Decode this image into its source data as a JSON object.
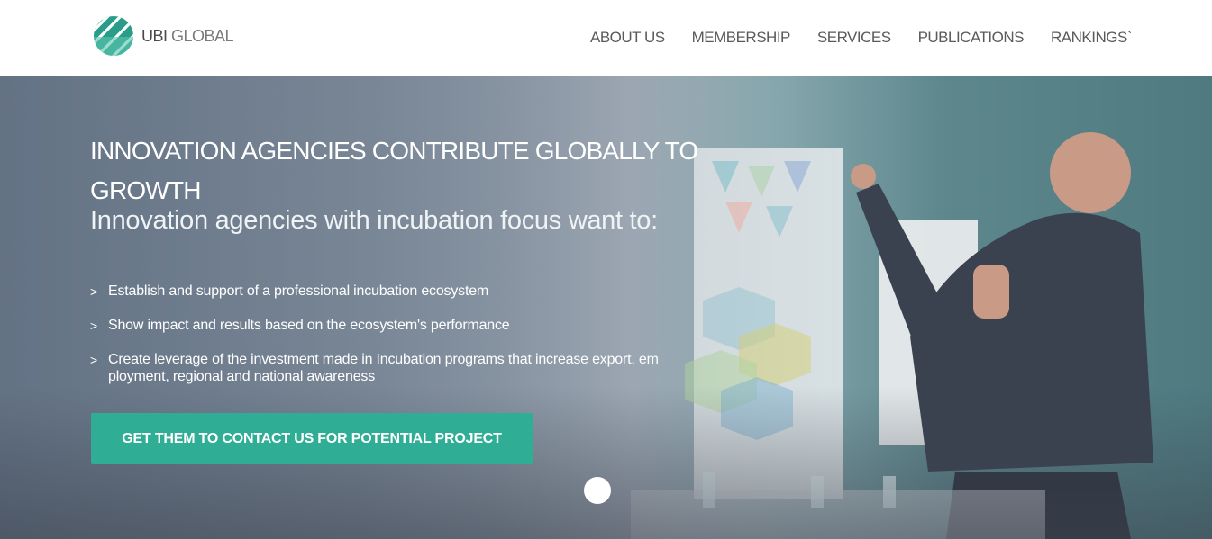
{
  "header": {
    "logo_text_bold": "UBI",
    "logo_text_light": " GLOBAL",
    "nav": [
      "ABOUT US",
      "MEMBERSHIP",
      "SERVICES",
      "PUBLICATIONS",
      "RANKINGS`"
    ]
  },
  "hero": {
    "headline": "INNOVATION AGENCIES CONTRIBUTE GLOBALLY TO GROWTH",
    "subhead": "Innovation agencies with incubation focus want to:",
    "bullet_marker": ">",
    "bullets": [
      "Establish and support of a professional incubation ecosystem",
      "Show impact and results based on the ecosystem's performance",
      "Create leverage of the investment made in Incubation programs that increase export, em ployment, regional and national awareness"
    ],
    "cta_label": "GET THEM TO CONTACT US FOR POTENTIAL PROJECT"
  },
  "colors": {
    "accent": "#2fae95",
    "nav_text": "#5a5a5a"
  },
  "icons": [
    "ubi-global-logo-icon",
    "scroll-indicator-icon"
  ]
}
